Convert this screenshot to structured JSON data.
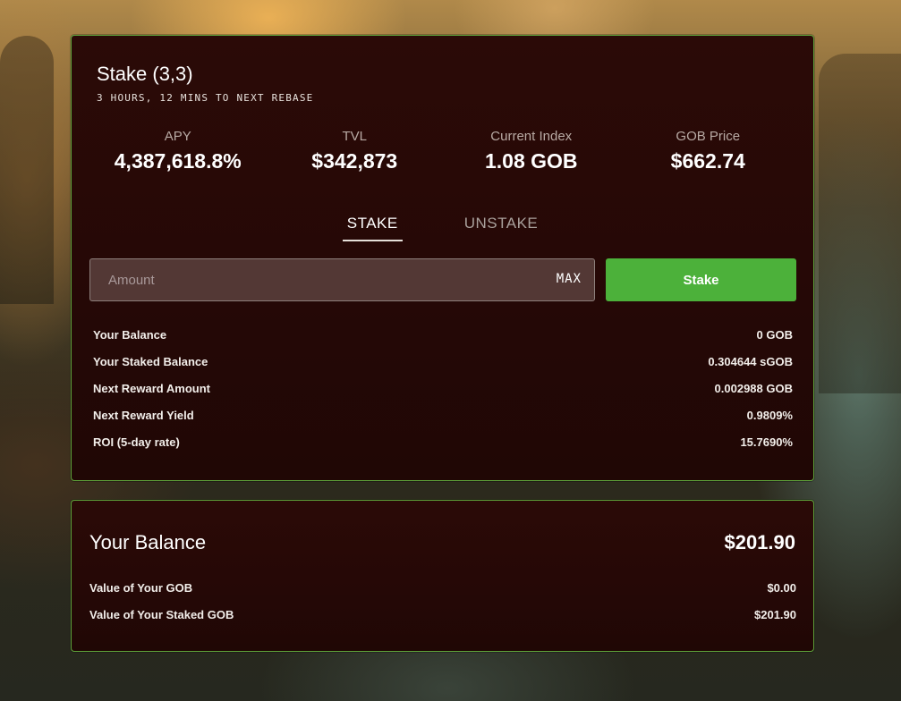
{
  "stake": {
    "title": "Stake (3,3)",
    "rebase_text": "3 HOURS, 12 MINS TO NEXT REBASE",
    "metrics": [
      {
        "label": "APY",
        "value": "4,387,618.8%"
      },
      {
        "label": "TVL",
        "value": "$342,873"
      },
      {
        "label": "Current Index",
        "value": "1.08 GOB"
      },
      {
        "label": "GOB Price",
        "value": "$662.74"
      }
    ],
    "tabs": [
      {
        "label": "STAKE",
        "active": true
      },
      {
        "label": "UNSTAKE",
        "active": false
      }
    ],
    "amount_placeholder": "Amount",
    "amount_value": "",
    "max_label": "MAX",
    "stake_button_label": "Stake",
    "rows": [
      {
        "label": "Your Balance",
        "value": "0 GOB"
      },
      {
        "label": "Your Staked Balance",
        "value": "0.304644 sGOB"
      },
      {
        "label": "Next Reward Amount",
        "value": "0.002988 GOB"
      },
      {
        "label": "Next Reward Yield",
        "value": "0.9809%"
      },
      {
        "label": "ROI (5-day rate)",
        "value": "15.7690%"
      }
    ]
  },
  "balance": {
    "title": "Your Balance",
    "total": "$201.90",
    "rows": [
      {
        "label": "Value of Your GOB",
        "value": "$0.00"
      },
      {
        "label": "Value of Your Staked GOB",
        "value": "$201.90"
      }
    ]
  },
  "colors": {
    "accent_green": "#4cb13a",
    "panel_border": "#5fa33a",
    "panel_bg": "#250806"
  }
}
